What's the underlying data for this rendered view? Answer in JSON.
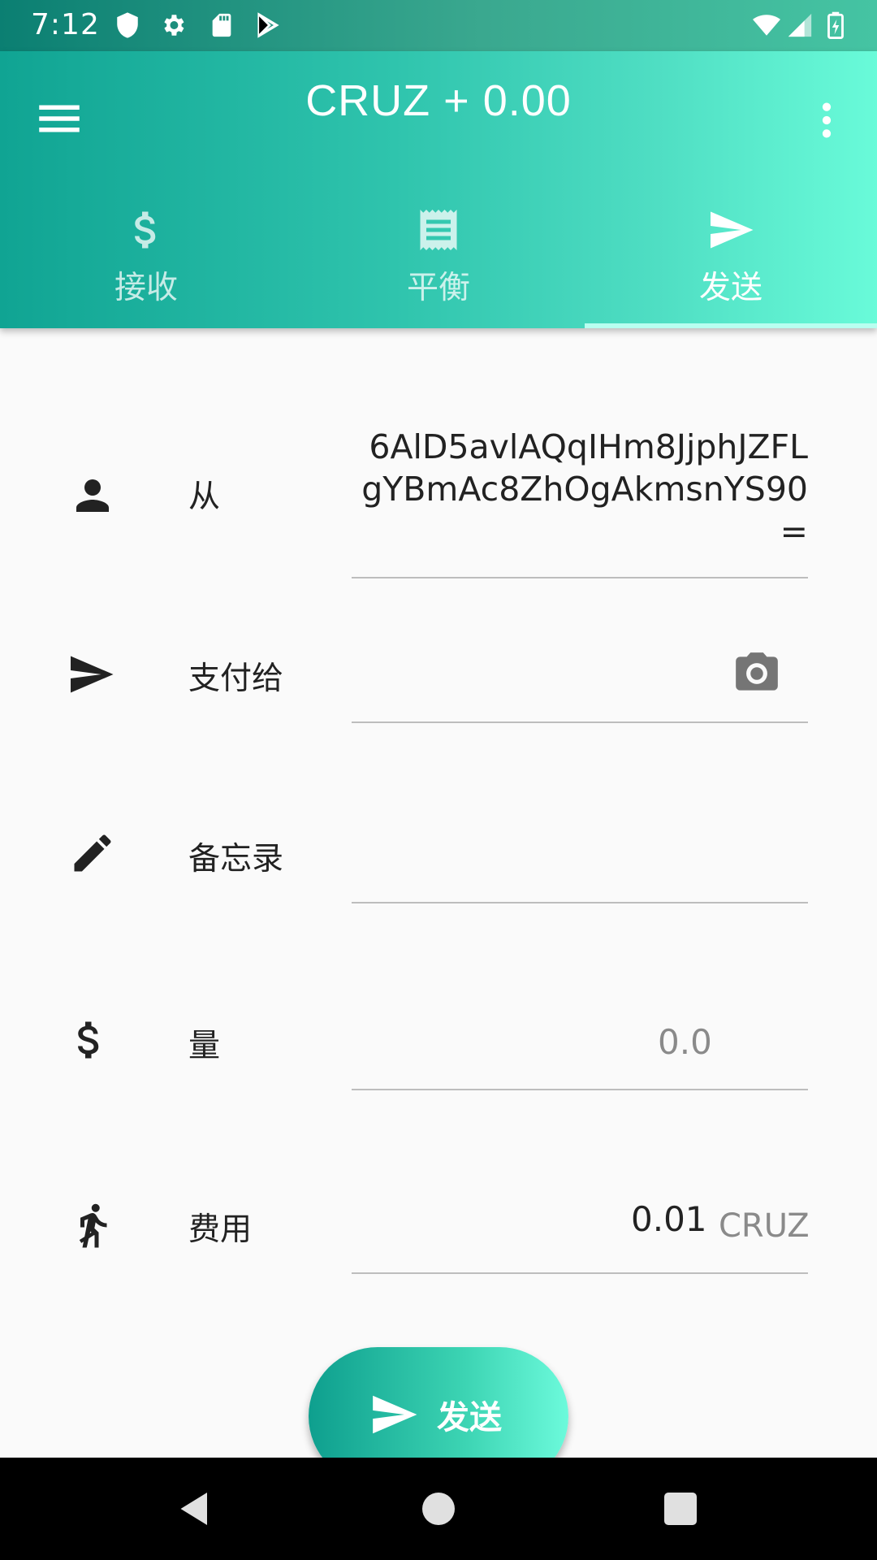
{
  "status_bar": {
    "time": "7:12",
    "icons": [
      "shield-icon",
      "gear-icon",
      "sd-card-icon",
      "play-store-icon",
      "wifi-icon",
      "signal-icon",
      "battery-icon"
    ]
  },
  "app_bar": {
    "title": "CRUZ + 0.00",
    "tabs": [
      {
        "label": "接收",
        "icon": "dollar-icon"
      },
      {
        "label": "平衡",
        "icon": "receipt-icon"
      },
      {
        "label": "发送",
        "icon": "send-icon",
        "active": true
      }
    ]
  },
  "form": {
    "from": {
      "label": "从",
      "value": "6AlD5avlAQqIHm8JjphJZFLgYBmAc8ZhOgAkmsnYS90="
    },
    "pay_to": {
      "label": "支付给",
      "value": ""
    },
    "memo": {
      "label": "备忘录",
      "value": ""
    },
    "amount": {
      "label": "量",
      "placeholder": "0.0"
    },
    "fee": {
      "label": "费用",
      "value": "0.01",
      "unit": "CRUZ"
    }
  },
  "send_button": {
    "label": "发送"
  },
  "colors": {
    "accent": "#2fc4ad",
    "accent_light": "#69fbd9",
    "accent_dark": "#0b7f72"
  }
}
